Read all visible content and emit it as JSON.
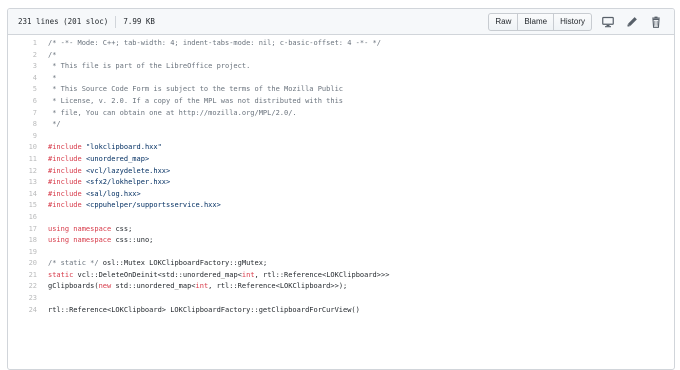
{
  "file_info": {
    "lines": "231 lines (201 sloc)",
    "size": "7.99 KB"
  },
  "actions": {
    "raw": "Raw",
    "blame": "Blame",
    "history": "History"
  },
  "icons": [
    "desktop-icon",
    "pencil-icon",
    "trash-icon"
  ],
  "code_lines": [
    {
      "n": "1",
      "parts": [
        {
          "t": "/* -*- Mode: C++; tab-width: 4; indent-tabs-mode: nil; c-basic-offset: 4 -*- */",
          "c": "c"
        }
      ]
    },
    {
      "n": "2",
      "parts": [
        {
          "t": "/*",
          "c": "c"
        }
      ]
    },
    {
      "n": "3",
      "parts": [
        {
          "t": " * This file is part of the LibreOffice project.",
          "c": "c"
        }
      ]
    },
    {
      "n": "4",
      "parts": [
        {
          "t": " *",
          "c": "c"
        }
      ]
    },
    {
      "n": "5",
      "parts": [
        {
          "t": " * This Source Code Form is subject to the terms of the Mozilla Public",
          "c": "c"
        }
      ]
    },
    {
      "n": "6",
      "parts": [
        {
          "t": " * License, v. 2.0. If a copy of the MPL was not distributed with this",
          "c": "c"
        }
      ]
    },
    {
      "n": "7",
      "parts": [
        {
          "t": " * file, You can obtain one at http://mozilla.org/MPL/2.0/.",
          "c": "c"
        }
      ]
    },
    {
      "n": "8",
      "parts": [
        {
          "t": " */",
          "c": "c"
        }
      ]
    },
    {
      "n": "9",
      "parts": []
    },
    {
      "n": "10",
      "parts": [
        {
          "t": "#include ",
          "c": "k"
        },
        {
          "t": "\"lokclipboard.hxx\"",
          "c": "s"
        }
      ]
    },
    {
      "n": "11",
      "parts": [
        {
          "t": "#include ",
          "c": "k"
        },
        {
          "t": "<unordered_map>",
          "c": "s"
        }
      ]
    },
    {
      "n": "12",
      "parts": [
        {
          "t": "#include ",
          "c": "k"
        },
        {
          "t": "<vcl/lazydelete.hxx>",
          "c": "s"
        }
      ]
    },
    {
      "n": "13",
      "parts": [
        {
          "t": "#include ",
          "c": "k"
        },
        {
          "t": "<sfx2/lokhelper.hxx>",
          "c": "s"
        }
      ]
    },
    {
      "n": "14",
      "parts": [
        {
          "t": "#include ",
          "c": "k"
        },
        {
          "t": "<sal/log.hxx>",
          "c": "s"
        }
      ]
    },
    {
      "n": "15",
      "parts": [
        {
          "t": "#include ",
          "c": "k"
        },
        {
          "t": "<cppuhelper/supportsservice.hxx>",
          "c": "s"
        }
      ]
    },
    {
      "n": "16",
      "parts": []
    },
    {
      "n": "17",
      "parts": [
        {
          "t": "using namespace ",
          "c": "k"
        },
        {
          "t": "css;",
          "c": ""
        }
      ]
    },
    {
      "n": "18",
      "parts": [
        {
          "t": "using namespace ",
          "c": "k"
        },
        {
          "t": "css::uno;",
          "c": ""
        }
      ]
    },
    {
      "n": "19",
      "parts": []
    },
    {
      "n": "20",
      "parts": [
        {
          "t": "/* static */ ",
          "c": "c"
        },
        {
          "t": "osl::Mutex LOKClipboardFactory::gMutex;",
          "c": ""
        }
      ]
    },
    {
      "n": "21",
      "parts": [
        {
          "t": "static ",
          "c": "k"
        },
        {
          "t": "vcl::DeleteOnDeinit<std::unordered_map<",
          "c": ""
        },
        {
          "t": "int",
          "c": "k"
        },
        {
          "t": ", rtl::Reference<LOKClipboard>>>",
          "c": ""
        }
      ]
    },
    {
      "n": "22",
      "parts": [
        {
          "t": "gClipboards(",
          "c": ""
        },
        {
          "t": "new ",
          "c": "k"
        },
        {
          "t": "std::unordered_map<",
          "c": ""
        },
        {
          "t": "int",
          "c": "k"
        },
        {
          "t": ", rtl::Reference<LOKClipboard>>);",
          "c": ""
        }
      ]
    },
    {
      "n": "23",
      "parts": []
    },
    {
      "n": "24",
      "parts": [
        {
          "t": "rtl::Reference<LOKClipboard> LOKClipboardFactory::getClipboardForCurView()",
          "c": ""
        }
      ]
    }
  ]
}
